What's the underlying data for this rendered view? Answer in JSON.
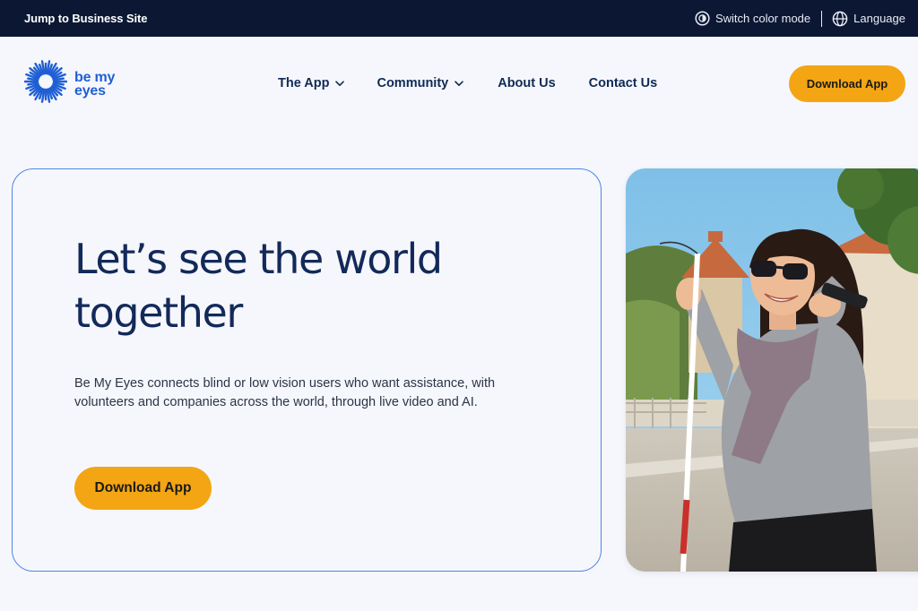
{
  "topbar": {
    "jump_label": "Jump to Business Site",
    "color_mode_label": "Switch color mode",
    "language_label": "Language"
  },
  "header": {
    "logo_line1": "be my",
    "logo_line2": "eyes",
    "nav": [
      {
        "label": "The App",
        "has_dropdown": true
      },
      {
        "label": "Community",
        "has_dropdown": true
      },
      {
        "label": "About Us",
        "has_dropdown": false
      },
      {
        "label": "Contact Us",
        "has_dropdown": false
      }
    ],
    "cta_label": "Download App"
  },
  "hero": {
    "title": "Let’s see the world together",
    "description": "Be My Eyes connects blind or low vision users who want assistance, with volunteers and companies across the world, through live video and AI.",
    "cta_label": "Download App"
  },
  "colors": {
    "topbar_bg": "#0b1733",
    "page_bg": "#f6f7fc",
    "brand_blue": "#1f5fd4",
    "accent_orange": "#f3a514",
    "heading_navy": "#13295a",
    "card_border": "#4c86e3"
  },
  "icons": {
    "color_mode": "contrast-icon",
    "language": "globe-icon",
    "dropdown": "chevron-down-icon",
    "logo": "sunburst-eye-logo"
  }
}
